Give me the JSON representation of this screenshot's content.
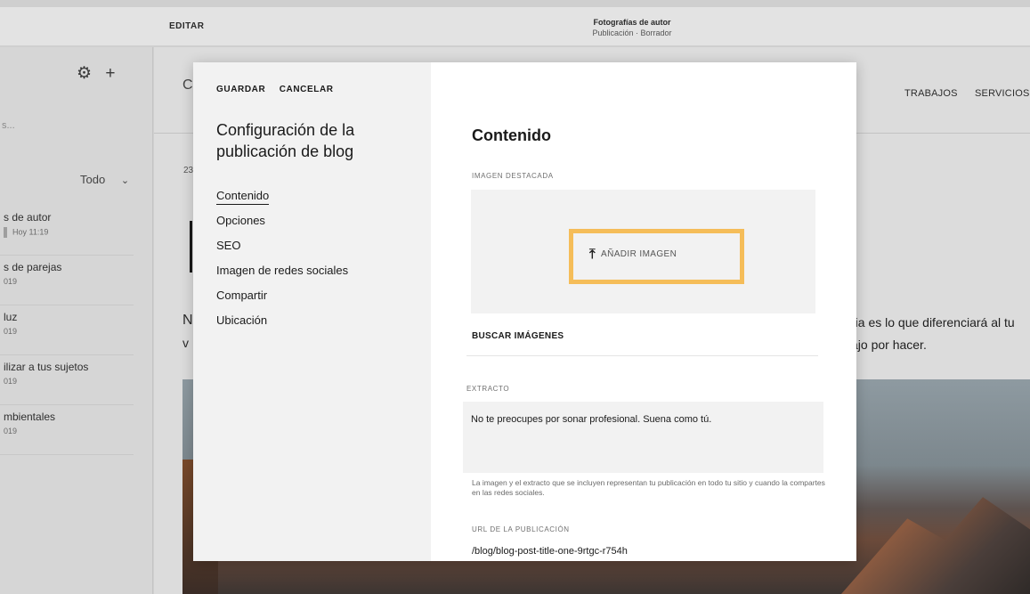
{
  "top_bar": {
    "edit_label": "EDITAR",
    "page_title": "Fotografías de autor",
    "page_subtitle": "Publicación · Borrador"
  },
  "left_panel": {
    "gear_icon": "⚙",
    "add_icon": "+",
    "search_fragment": "s...",
    "filter_label": "Todo",
    "posts": [
      {
        "title": "s de autor",
        "date": "Hoy 11:19"
      },
      {
        "title": "s de parejas",
        "date": "019"
      },
      {
        "title": "luz",
        "date": "019"
      },
      {
        "title": "ilizar a tus sujetos",
        "date": "019"
      },
      {
        "title": "mbientales",
        "date": "019"
      }
    ]
  },
  "site_preview": {
    "logo_fragment": "C",
    "nav": [
      "TRABAJOS",
      "SERVICIOS"
    ],
    "date_fragment": "23",
    "body_n_fragment": "N",
    "body_v_fragment": "v",
    "body_right_line1": "ria es lo que diferenciará al tu",
    "body_right_line2": "ajo por hacer."
  },
  "modal": {
    "save_label": "GUARDAR",
    "cancel_label": "CANCELAR",
    "title": "Configuración de la publicación de blog",
    "nav": [
      {
        "label": "Contenido",
        "active": true
      },
      {
        "label": "Opciones",
        "active": false
      },
      {
        "label": "SEO",
        "active": false
      },
      {
        "label": "Imagen de redes sociales",
        "active": false
      },
      {
        "label": "Compartir",
        "active": false
      },
      {
        "label": "Ubicación",
        "active": false
      }
    ],
    "content": {
      "heading": "Contenido",
      "featured_image_label": "IMAGEN DESTACADA",
      "add_image_label": "AÑADIR IMAGEN",
      "highlight_color": "#f5bd59",
      "search_images_label": "BUSCAR IMÁGENES",
      "excerpt_label": "EXTRACTO",
      "excerpt_value": "No te preocupes por sonar profesional. Suena como tú.",
      "help_text": "La imagen y el extracto que se incluyen representan tu publicación en todo tu sitio y cuando la compartes en las redes sociales.",
      "url_label": "URL DE LA PUBLICACIÓN",
      "url_value": "/blog/blog-post-title-one-9rtgc-r754h"
    }
  }
}
